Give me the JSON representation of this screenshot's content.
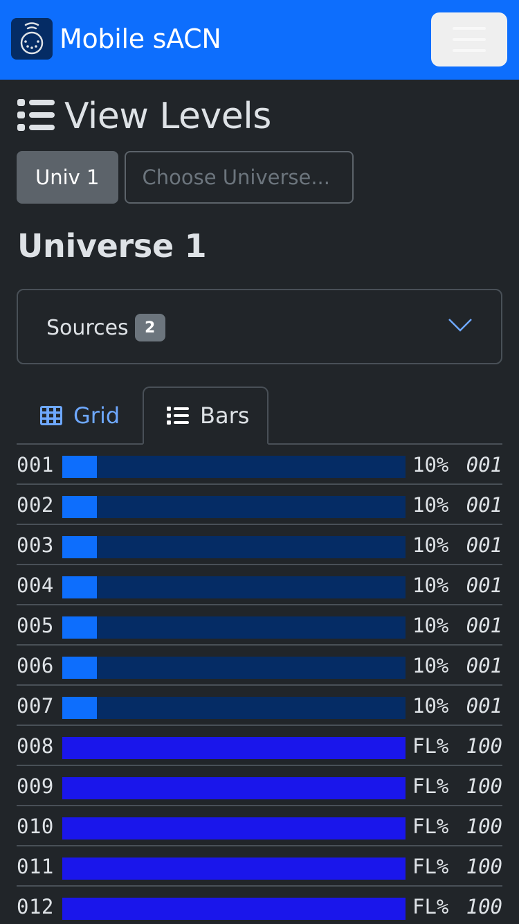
{
  "navbar": {
    "brand": "Mobile sACN",
    "brand_icon": "dmx-connector-icon",
    "menu_icon": "hamburger-icon",
    "bg_color": "#0d6efd"
  },
  "page": {
    "title": "View Levels",
    "title_icon": "list-icon"
  },
  "universe_selector": {
    "selected_label": "Univ 1",
    "choose_placeholder": "Choose Universe..."
  },
  "universe_heading": "Universe 1",
  "sources": {
    "label": "Sources",
    "count": "2",
    "icon": "chevron-down-icon"
  },
  "tabs": [
    {
      "label": "Grid",
      "icon": "grid-icon",
      "active": false
    },
    {
      "label": "Bars",
      "icon": "list-icon",
      "active": true
    }
  ],
  "colors": {
    "bar_track": "#052c65",
    "bar_fill_partial": "#0d6efd",
    "bar_fill_full": "#1a16eb"
  },
  "levels": [
    {
      "address": "001",
      "percent_label": "10%",
      "level_fraction": 0.1,
      "source": "001",
      "color": "#0d6efd"
    },
    {
      "address": "002",
      "percent_label": "10%",
      "level_fraction": 0.1,
      "source": "001",
      "color": "#0d6efd"
    },
    {
      "address": "003",
      "percent_label": "10%",
      "level_fraction": 0.1,
      "source": "001",
      "color": "#0d6efd"
    },
    {
      "address": "004",
      "percent_label": "10%",
      "level_fraction": 0.1,
      "source": "001",
      "color": "#0d6efd"
    },
    {
      "address": "005",
      "percent_label": "10%",
      "level_fraction": 0.1,
      "source": "001",
      "color": "#0d6efd"
    },
    {
      "address": "006",
      "percent_label": "10%",
      "level_fraction": 0.1,
      "source": "001",
      "color": "#0d6efd"
    },
    {
      "address": "007",
      "percent_label": "10%",
      "level_fraction": 0.1,
      "source": "001",
      "color": "#0d6efd"
    },
    {
      "address": "008",
      "percent_label": "FL%",
      "level_fraction": 1.0,
      "source": "100",
      "color": "#1a16eb"
    },
    {
      "address": "009",
      "percent_label": "FL%",
      "level_fraction": 1.0,
      "source": "100",
      "color": "#1a16eb"
    },
    {
      "address": "010",
      "percent_label": "FL%",
      "level_fraction": 1.0,
      "source": "100",
      "color": "#1a16eb"
    },
    {
      "address": "011",
      "percent_label": "FL%",
      "level_fraction": 1.0,
      "source": "100",
      "color": "#1a16eb"
    },
    {
      "address": "012",
      "percent_label": "FL%",
      "level_fraction": 1.0,
      "source": "100",
      "color": "#1a16eb"
    }
  ]
}
